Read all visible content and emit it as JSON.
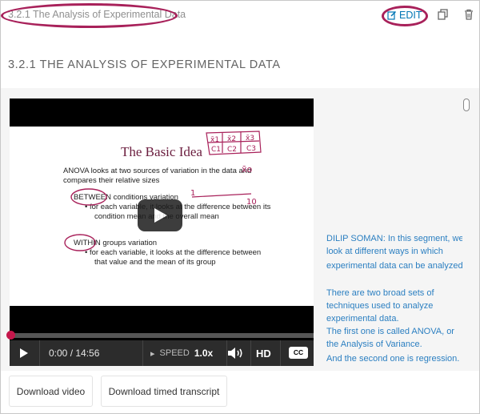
{
  "header": {
    "unit_title": "3.2.1 The Analysis of Experimental Data",
    "edit_label": "EDIT"
  },
  "section": {
    "heading": "3.2.1 THE ANALYSIS OF EXPERIMENTAL DATA"
  },
  "slide": {
    "title": "The Basic Idea",
    "line1": "ANOVA looks at two sources of variation in the data and",
    "line2": "compares their relative sizes",
    "between_word": "BETWEEN",
    "between_rest": " conditions variation",
    "bullet1a": "• for each variable, it looks at the difference between its",
    "bullet1b": "condition mean and the overall mean",
    "within_word": "WITHIN",
    "within_rest": " groups variation",
    "bullet2a": "• for each variable, it looks at the difference between",
    "bullet2b": "that value and the mean of its group",
    "annot_x1": "x̄1",
    "annot_x2": "x̄2",
    "annot_x3": "x̄3",
    "annot_c1": "C1",
    "annot_c2": "C2",
    "annot_c3": "C3",
    "annot_xo": "x̄o",
    "annot_1": "1",
    "annot_10": "10"
  },
  "video": {
    "progress": 0.0,
    "time": "0:00 / 14:56",
    "speed_label": "SPEED",
    "speed_value": "1.0x",
    "hd_label": "HD",
    "cc_label": "CC"
  },
  "transcript": [
    "DILIP SOMAN: In this segment, we look at different ways in which",
    "experimental data can be analyzed.",
    "There are two broad sets of techniques used to analyze experimental data.",
    "The first one is called ANOVA, or the Analysis of Variance.",
    "And the second one is regression."
  ],
  "downloads": {
    "video_label": "Download video",
    "transcript_label": "Download timed transcript"
  },
  "colors": {
    "annotation": "#a8215a",
    "link": "#0075b4",
    "transcript": "#2b7fc1",
    "slide_title": "#6b1e3f"
  },
  "icons": [
    "pencil-icon",
    "duplicate-icon",
    "trash-icon",
    "play-icon",
    "volume-icon"
  ]
}
